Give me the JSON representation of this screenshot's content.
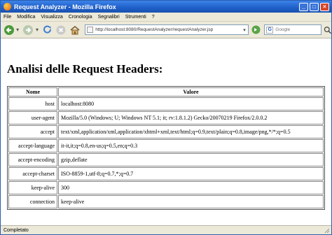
{
  "window": {
    "title": "Request Analyzer - Mozilla Firefox",
    "minimize": "_",
    "maximize": "□",
    "close": "×"
  },
  "menu": [
    "File",
    "Modifica",
    "Visualizza",
    "Cronologia",
    "Segnalibri",
    "Strumenti",
    "?"
  ],
  "toolbar": {
    "address": "http://localhost:8080/RequestAnalyzer/requestAnalyzer.jsp",
    "search_placeholder": "Google",
    "icons": [
      "back-icon",
      "forward-icon",
      "reload-icon",
      "stop-icon",
      "home-icon",
      "go-icon",
      "google-icon",
      "search-icon"
    ]
  },
  "page": {
    "title": "Analisi delle Request Headers:",
    "columns": {
      "name": "Nome",
      "value": "Valore"
    },
    "rows": [
      {
        "name": "host",
        "value": "localhost:8080"
      },
      {
        "name": "user-agent",
        "value": "Mozilla/5.0 (Windows; U; Windows NT 5.1; it; rv:1.8.1.2) Gecko/20070219 Firefox/2.0.0.2"
      },
      {
        "name": "accept",
        "value": "text/xml,application/xml,application/xhtml+xml,text/html;q=0.9,text/plain;q=0.8,image/png,*/*;q=0.5"
      },
      {
        "name": "accept-language",
        "value": "it-it,it;q=0.8,en-us;q=0.5,en;q=0.3"
      },
      {
        "name": "accept-encoding",
        "value": "gzip,deflate"
      },
      {
        "name": "accept-charset",
        "value": "ISO-8859-1,utf-8;q=0.7,*;q=0.7"
      },
      {
        "name": "keep-alive",
        "value": "300"
      },
      {
        "name": "connection",
        "value": "keep-alive"
      }
    ]
  },
  "status": {
    "text": "Completato"
  },
  "colors": {
    "titlebar": "#1f5fc8",
    "chrome": "#ece9d8"
  }
}
